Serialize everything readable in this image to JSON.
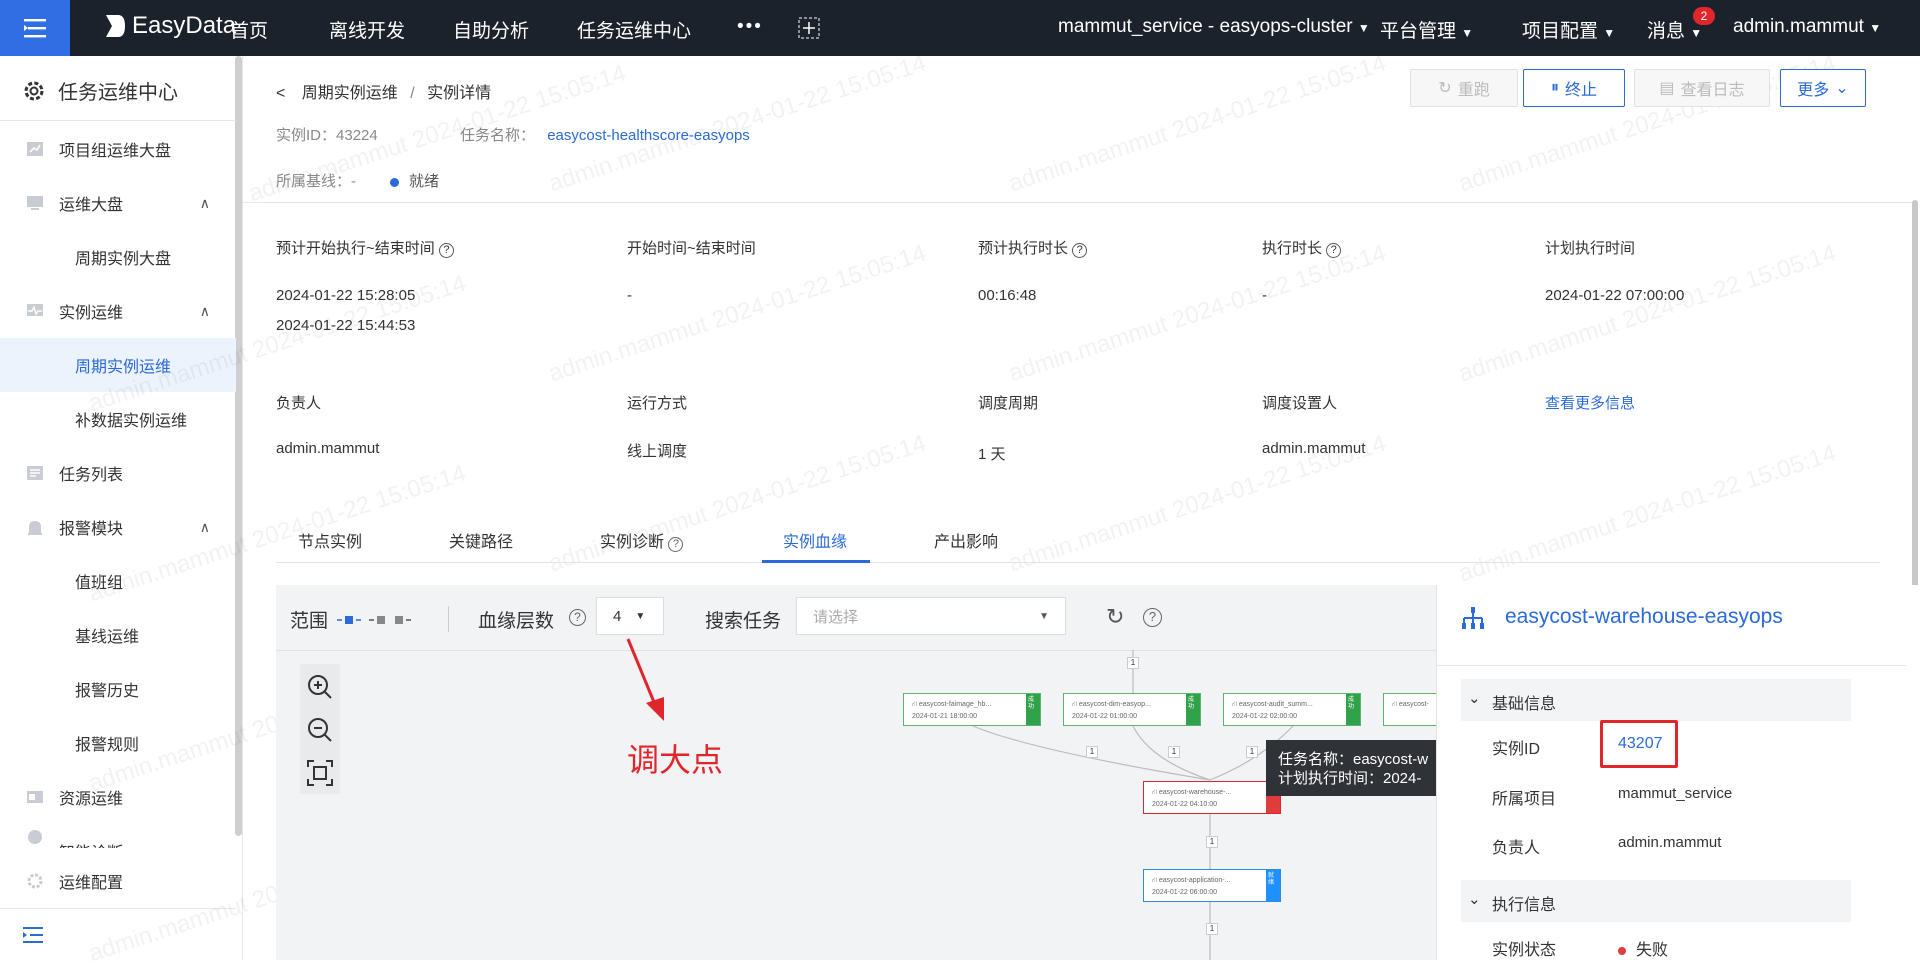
{
  "topbar": {
    "logo": "EasyData",
    "nav": [
      "首页",
      "离线开发",
      "自助分析",
      "任务运维中心"
    ],
    "more": "•••",
    "cluster": "mammut_service - easyops-cluster",
    "platform": "平台管理",
    "project_cfg": "项目配置",
    "messages": "消息",
    "msg_badge": "2",
    "user": "admin.mammut"
  },
  "sidebar": {
    "title": "任务运维中心",
    "items": [
      {
        "label": "项目组运维大盘"
      },
      {
        "label": "运维大盘"
      },
      {
        "label": "周期实例大盘"
      },
      {
        "label": "实例运维"
      },
      {
        "label": "周期实例运维"
      },
      {
        "label": "补数据实例运维"
      },
      {
        "label": "任务列表"
      },
      {
        "label": "报警模块"
      },
      {
        "label": "值班组"
      },
      {
        "label": "基线运维"
      },
      {
        "label": "报警历史"
      },
      {
        "label": "报警规则"
      },
      {
        "label": "资源运维"
      },
      {
        "label": "智能诊断"
      },
      {
        "label": "运维配置"
      }
    ]
  },
  "header": {
    "breadcrumb_parent": "周期实例运维",
    "breadcrumb_sep": "/",
    "breadcrumb_current": "实例详情",
    "instance_id_label": "实例ID：",
    "instance_id": "43224",
    "task_name_label": "任务名称：",
    "task_name": "easycost-healthscore-easyops",
    "baseline_label": "所属基线：",
    "baseline_value": "-",
    "status": "就绪",
    "buttons": {
      "rerun": "重跑",
      "stop": "终止",
      "view_log": "查看日志",
      "more": "更多"
    }
  },
  "info": {
    "planned_label": "预计开始执行~结束时间",
    "planned_start": "2024-01-22 15:28:05",
    "planned_end": "2024-01-22 15:44:53",
    "actual_label": "开始时间~结束时间",
    "actual_value": "-",
    "est_duration_label": "预计执行时长",
    "est_duration": "00:16:48",
    "duration_label": "执行时长",
    "duration": "-",
    "plan_time_label": "计划执行时间",
    "plan_time": "2024-01-22 07:00:00",
    "owner_label": "负责人",
    "owner": "admin.mammut",
    "run_mode_label": "运行方式",
    "run_mode": "线上调度",
    "cycle_label": "调度周期",
    "cycle": "1 天",
    "scheduler_label": "调度设置人",
    "scheduler": "admin.mammut",
    "more_info": "查看更多信息"
  },
  "tabs": [
    "节点实例",
    "关键路径",
    "实例诊断",
    "实例血缘",
    "产出影响"
  ],
  "active_tab": "实例血缘",
  "graph": {
    "scope_label": "范围",
    "depth_label": "血缘层数",
    "depth_value": "4",
    "search_label": "搜索任务",
    "search_placeholder": "请选择",
    "annotation": "调大点",
    "tooltip_name": "任务名称：easycost-w",
    "tooltip_time": "计划执行时间：2024-",
    "nodes": [
      {
        "name": "easycost-faimage_hb...",
        "time": "2024-01-21 18:00:00",
        "flag": "成功"
      },
      {
        "name": "easycost-dim-easyop...",
        "time": "2024-01-22 01:00:00",
        "flag": "成功"
      },
      {
        "name": "easycost-audit_summ...",
        "time": "2024-01-22 02:00:00",
        "flag": "成功"
      },
      {
        "name": "easycost-",
        "time": "",
        "flag": ""
      },
      {
        "name": "easycost-warehouse-...",
        "time": "2024-01-22 04:10:00",
        "flag": ""
      },
      {
        "name": "easycost-application-...",
        "time": "2024-01-22 06:00:00",
        "flag": "就绪"
      }
    ],
    "edge_labels": [
      "1",
      "1",
      "1",
      "1",
      "1",
      "1"
    ]
  },
  "detail_panel": {
    "title": "easycost-warehouse-easyops",
    "basic_section": "基础信息",
    "instance_id_label": "实例ID",
    "instance_id": "43207",
    "project_label": "所属项目",
    "project": "mammut_service",
    "owner_label": "负责人",
    "owner": "admin.mammut",
    "exec_section": "执行信息",
    "status_label": "实例状态",
    "status": "失败"
  },
  "watermark": "admin.mammut 2024-01-22 15:05:14",
  "colors": {
    "accent": "#2a6ad9",
    "topbar": "#1c222b",
    "success": "#2fa24a",
    "fail": "#e03c3c",
    "highlight": "#e0262b"
  }
}
